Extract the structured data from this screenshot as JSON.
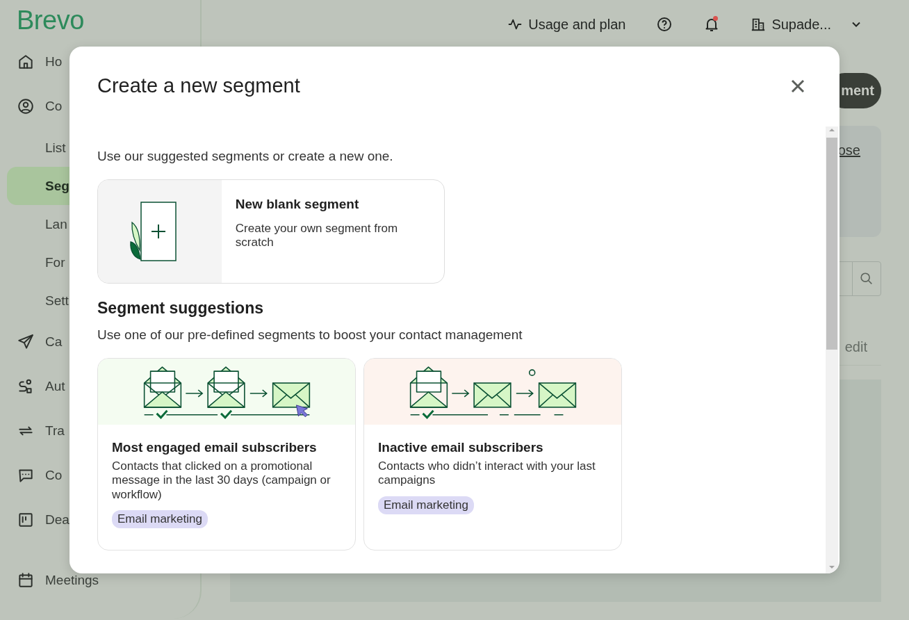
{
  "app": {
    "logo": "Brevo"
  },
  "sidebar": {
    "items": [
      {
        "label": "Ho",
        "kind": "main",
        "selected": false
      },
      {
        "label": "Co",
        "kind": "main",
        "selected": false
      },
      {
        "label": "List",
        "kind": "sub",
        "selected": false
      },
      {
        "label": "Seg",
        "kind": "sub",
        "selected": true
      },
      {
        "label": "Lan",
        "kind": "sub",
        "selected": false
      },
      {
        "label": "For",
        "kind": "sub",
        "selected": false
      },
      {
        "label": "Sett",
        "kind": "sub",
        "selected": false
      },
      {
        "label": "Ca",
        "kind": "main",
        "selected": false
      },
      {
        "label": "Aut",
        "kind": "main",
        "selected": false
      },
      {
        "label": "Tra",
        "kind": "main",
        "selected": false
      },
      {
        "label": "Co",
        "kind": "main",
        "selected": false
      },
      {
        "label": "Dea",
        "kind": "main",
        "selected": false
      },
      {
        "label": "Meetings",
        "kind": "main",
        "selected": false
      }
    ]
  },
  "top_bar": {
    "usage": "Usage and plan",
    "notification": true,
    "account": "Supade..."
  },
  "page": {
    "button": "ment",
    "link": "ose",
    "column": "edit"
  },
  "modal": {
    "title": "Create a new segment",
    "intro": "Use our suggested segments or create a new one.",
    "blank_card": {
      "title": "New blank segment",
      "description": "Create your own segment from scratch"
    },
    "suggestions": {
      "heading": "Segment suggestions",
      "description": "Use one of our pre-defined segments to boost your contact management",
      "cards": [
        {
          "kind": "engaged",
          "title": "Most engaged email subscribers",
          "description": "Contacts that clicked on a promotional message in the last 30 days (campaign or workflow)",
          "tag": "Email marketing"
        },
        {
          "kind": "inactive",
          "title": "Inactive email subscribers",
          "description": "Contacts who didn’t interact with your last campaigns",
          "tag": "Email marketing"
        }
      ]
    }
  }
}
